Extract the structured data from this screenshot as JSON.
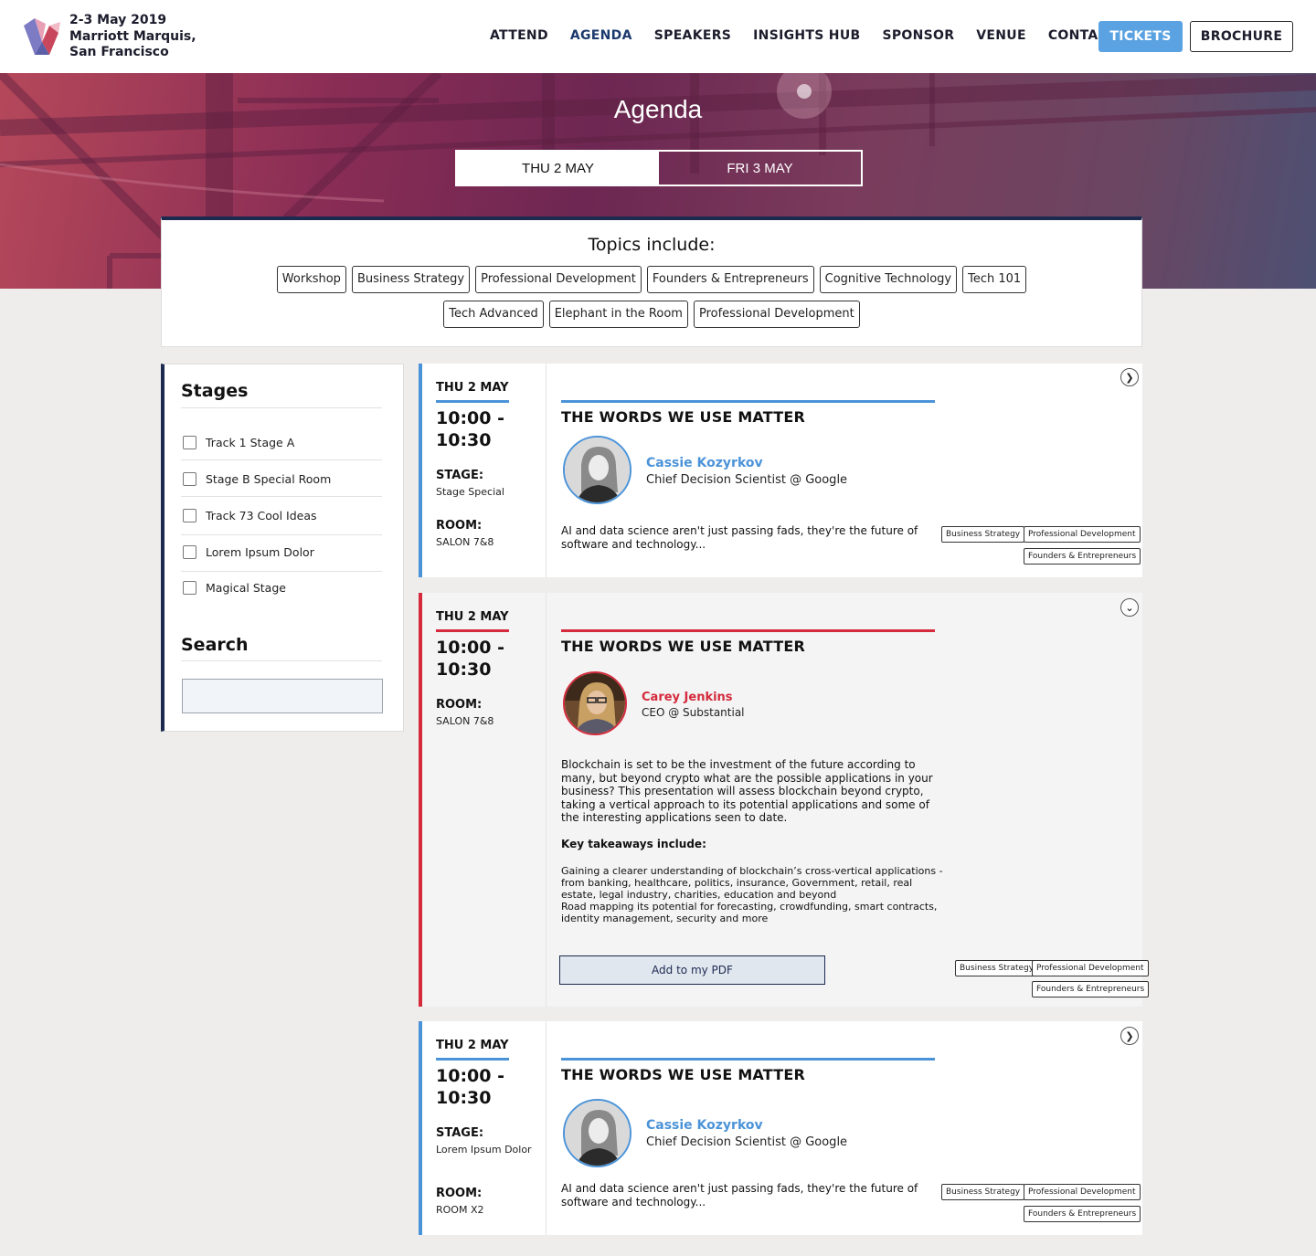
{
  "header": {
    "event_date": "2-3 May 2019",
    "venue_line1": "Marriott Marquis,",
    "venue_line2": "San Francisco",
    "nav": [
      "ATTEND",
      "AGENDA",
      "SPEAKERS",
      "INSIGHTS HUB",
      "SPONSOR",
      "VENUE",
      "CONTACT"
    ],
    "active_nav": "AGENDA",
    "tickets_label": "TICKETS",
    "brochure_label": "BROCHURE",
    "accent": "#5aa2e2"
  },
  "hero": {
    "title": "Agenda",
    "tabs": [
      "THU 2 MAY",
      "FRI 3 MAY"
    ],
    "active_tab": "THU 2 MAY"
  },
  "topics": {
    "title": "Topics include:",
    "row1": [
      "Workshop",
      "Business Strategy",
      "Professional Development",
      "Founders & Entrepreneurs",
      "Cognitive Technology",
      "Tech 101"
    ],
    "row2": [
      "Tech Advanced",
      "Elephant in the Room",
      "Professional Development"
    ]
  },
  "sidebar": {
    "stages_title": "Stages",
    "stages": [
      "Track 1 Stage A",
      "Stage B Special Room",
      "Track 73 Cool Ideas",
      "Lorem Ipsum Dolor",
      "Magical Stage"
    ],
    "search_title": "Search",
    "search_value": ""
  },
  "sessions": [
    {
      "day": "THU 2 MAY",
      "time_start": "10:00 -",
      "time_end": "10:30",
      "stage_label": "STAGE:",
      "stage": "Stage Special",
      "room_label": "ROOM:",
      "room": "SALON 7&8",
      "title": "THE WORDS WE USE MATTER",
      "speaker_name": "Cassie Kozyrkov",
      "speaker_role": "Chief Decision Scientist @ Google",
      "description": "AI and data science aren't just passing fads, they're the future of software and technology...",
      "tags": [
        "Business Strategy",
        "Professional Development",
        "Founders & Entrepreneurs"
      ],
      "toggle_icon": "chevron-right-icon",
      "accent": "#4b93d8"
    },
    {
      "day": "THU 2 MAY",
      "time_start": "10:00 -",
      "time_end": "10:30",
      "room_label": "ROOM:",
      "room": "SALON 7&8",
      "title": "THE WORDS WE USE MATTER",
      "speaker_name": "Carey Jenkins",
      "speaker_role": "CEO @ Substantial",
      "description": "Blockchain is set to be the investment of the future according to many, but beyond crypto what are the possible applications in your business? This presentation will assess blockchain beyond crypto, taking a vertical approach to its potential applications and some of the interesting applications seen to date.",
      "takeaways_title": "Key takeaways include:",
      "takeaways_1": "Gaining a clearer understanding of blockchain’s cross-vertical applications - from banking, healthcare, politics, insurance, Government, retail, real estate, legal industry, charities, education and beyond",
      "takeaways_2": "Road mapping its potential for forecasting, crowdfunding, smart contracts, identity management, security and more",
      "pdf_label": "Add to my PDF",
      "tags": [
        "Business Strategy",
        "Professional Development",
        "Founders & Entrepreneurs"
      ],
      "toggle_icon": "chevron-down-icon",
      "accent": "#d42a3c"
    },
    {
      "day": "THU 2 MAY",
      "time_start": "10:00 -",
      "time_end": "10:30",
      "stage_label": "STAGE:",
      "stage": "Lorem Ipsum Dolor",
      "room_label": "ROOM:",
      "room": "ROOM X2",
      "title": "THE WORDS WE USE MATTER",
      "speaker_name": "Cassie Kozyrkov",
      "speaker_role": "Chief Decision Scientist @ Google",
      "description": "AI and data science aren't just passing fads, they're the future of software and technology...",
      "tags": [
        "Business Strategy",
        "Professional Development",
        "Founders & Entrepreneurs"
      ],
      "toggle_icon": "chevron-right-icon",
      "accent": "#4b93d8"
    }
  ]
}
